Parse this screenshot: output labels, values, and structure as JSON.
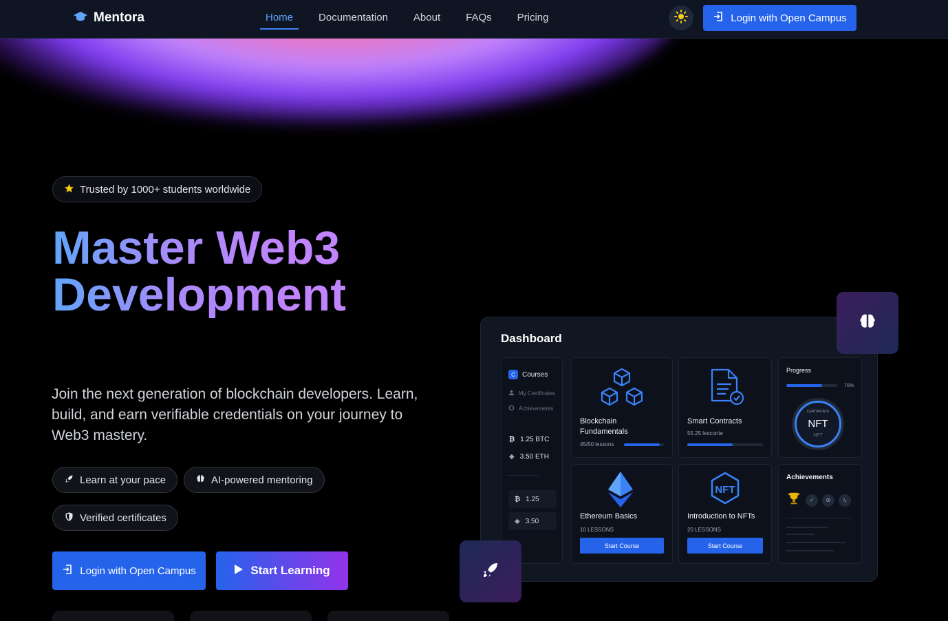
{
  "brand": {
    "name": "Mentora",
    "icon": "graduation-cap-icon"
  },
  "nav": {
    "links": [
      "Home",
      "Documentation",
      "About",
      "FAQs",
      "Pricing"
    ],
    "active": "Home",
    "login_label": "Login with Open Campus",
    "theme_icon": "sun-icon"
  },
  "hero": {
    "trust_badge": "Trusted by 1000+ students worldwide",
    "headline_line1": "Master Web3",
    "headline_line2": "Development",
    "subtitle": "Join the next generation of blockchain developers. Learn, build, and earn verifiable credentials on your journey to Web3 mastery.",
    "features": [
      "Learn at your pace",
      "AI-powered mentoring",
      "Verified certificates"
    ],
    "login_button": "Login with Open Campus",
    "start_button": "Start Learning"
  },
  "dashboard": {
    "title": "Dashboard",
    "sidebar": {
      "active_badge": "C",
      "active_label": "Courses",
      "items": [
        "My Certificates",
        "Achievements"
      ],
      "balances": [
        {
          "value": "1.25 BTC",
          "icon": "bitcoin-icon"
        },
        {
          "value": "3.50 ETH",
          "icon": "ethereum-icon"
        }
      ],
      "mini": [
        {
          "value": "1.25",
          "icon": "bitcoin-icon"
        },
        {
          "value": "3.50",
          "icon": "ethereum-icon"
        }
      ]
    },
    "courses": [
      {
        "title_line1": "Blockchain",
        "title_line2": "Fundamentals",
        "meta": "45/50 lessons",
        "progress": 0.9,
        "icon": "blocks-icon"
      },
      {
        "title_line1": "Smart Contracts",
        "title_line2": "",
        "meta": "55.25 lesconte",
        "progress": 0.6,
        "icon": "contract-icon"
      },
      {
        "title_line1": "Ethereum Basics",
        "title_line2": "",
        "meta": "10 LESSONS",
        "button": "Start Course",
        "icon": "ethereum-logo-icon"
      },
      {
        "title_line1": "Introduction to NFTs",
        "title_line2": "",
        "meta": "20 LESSONS",
        "button": "Start Course",
        "icon": "nft-hexagon-icon"
      }
    ],
    "progress_panel": {
      "title": "Progress",
      "percent_label": "70%",
      "value": 0.7,
      "badge_top": "CERTIFICATE",
      "badge_main": "NFT",
      "badge_bottom": "NFT"
    },
    "achievements_panel": {
      "title": "Achievements",
      "icons": [
        "trophy-icon",
        "check-icon",
        "link-icon",
        "bolt-icon"
      ]
    }
  },
  "floating": {
    "brain_icon": "brain-icon",
    "rocket_icon": "rocket-icon"
  },
  "colors": {
    "accent": "#2563eb",
    "nav_bg": "#0f1523",
    "gradient_start": "#60a5fa",
    "gradient_end": "#c084fc"
  }
}
